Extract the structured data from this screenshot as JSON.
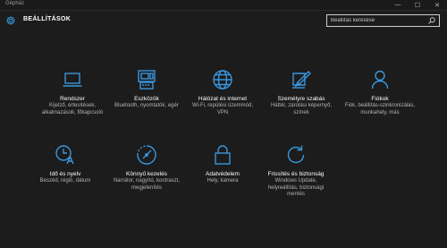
{
  "window": {
    "title": "Gépház",
    "controls": {
      "minimize": "—",
      "maximize": "☐",
      "close": "✕"
    }
  },
  "header": {
    "title": "BEÁLLÍTÁSOK",
    "gear_icon": "gear-icon"
  },
  "search": {
    "placeholder": "Beállítás keresése",
    "icon": "search-icon"
  },
  "accent_color": "#3a96dd",
  "tiles": [
    {
      "icon": "laptop-icon",
      "title": "Rendszer",
      "desc": "Kijelző, értesítések, alkalmazások, főkapcsoló"
    },
    {
      "icon": "devices-icon",
      "title": "Eszközök",
      "desc": "Bluetooth, nyomtatók, egér"
    },
    {
      "icon": "globe-icon",
      "title": "Hálózat és internet",
      "desc": "Wi-Fi, repülési üzemmód, VPN"
    },
    {
      "icon": "personalize-icon",
      "title": "Személyre szabás",
      "desc": "Háttér, zárolási képernyő, színek"
    },
    {
      "icon": "person-icon",
      "title": "Fiókok",
      "desc": "Fiók, beállítás-szinkronizálás, munkahely, más"
    },
    {
      "icon": "time-language-icon",
      "title": "Idő és nyelv",
      "desc": "Beszéd, régió, dátum"
    },
    {
      "icon": "ease-of-access-icon",
      "title": "Könnyű kezelés",
      "desc": "Narrátor, nagyító, kontraszt, megjelenítés"
    },
    {
      "icon": "lock-icon",
      "title": "Adatvédelem",
      "desc": "Hely, kamera"
    },
    {
      "icon": "update-icon",
      "title": "Frissítés és biztonság",
      "desc": "Windows Update, helyreállítás, biztonsági mentés"
    }
  ]
}
